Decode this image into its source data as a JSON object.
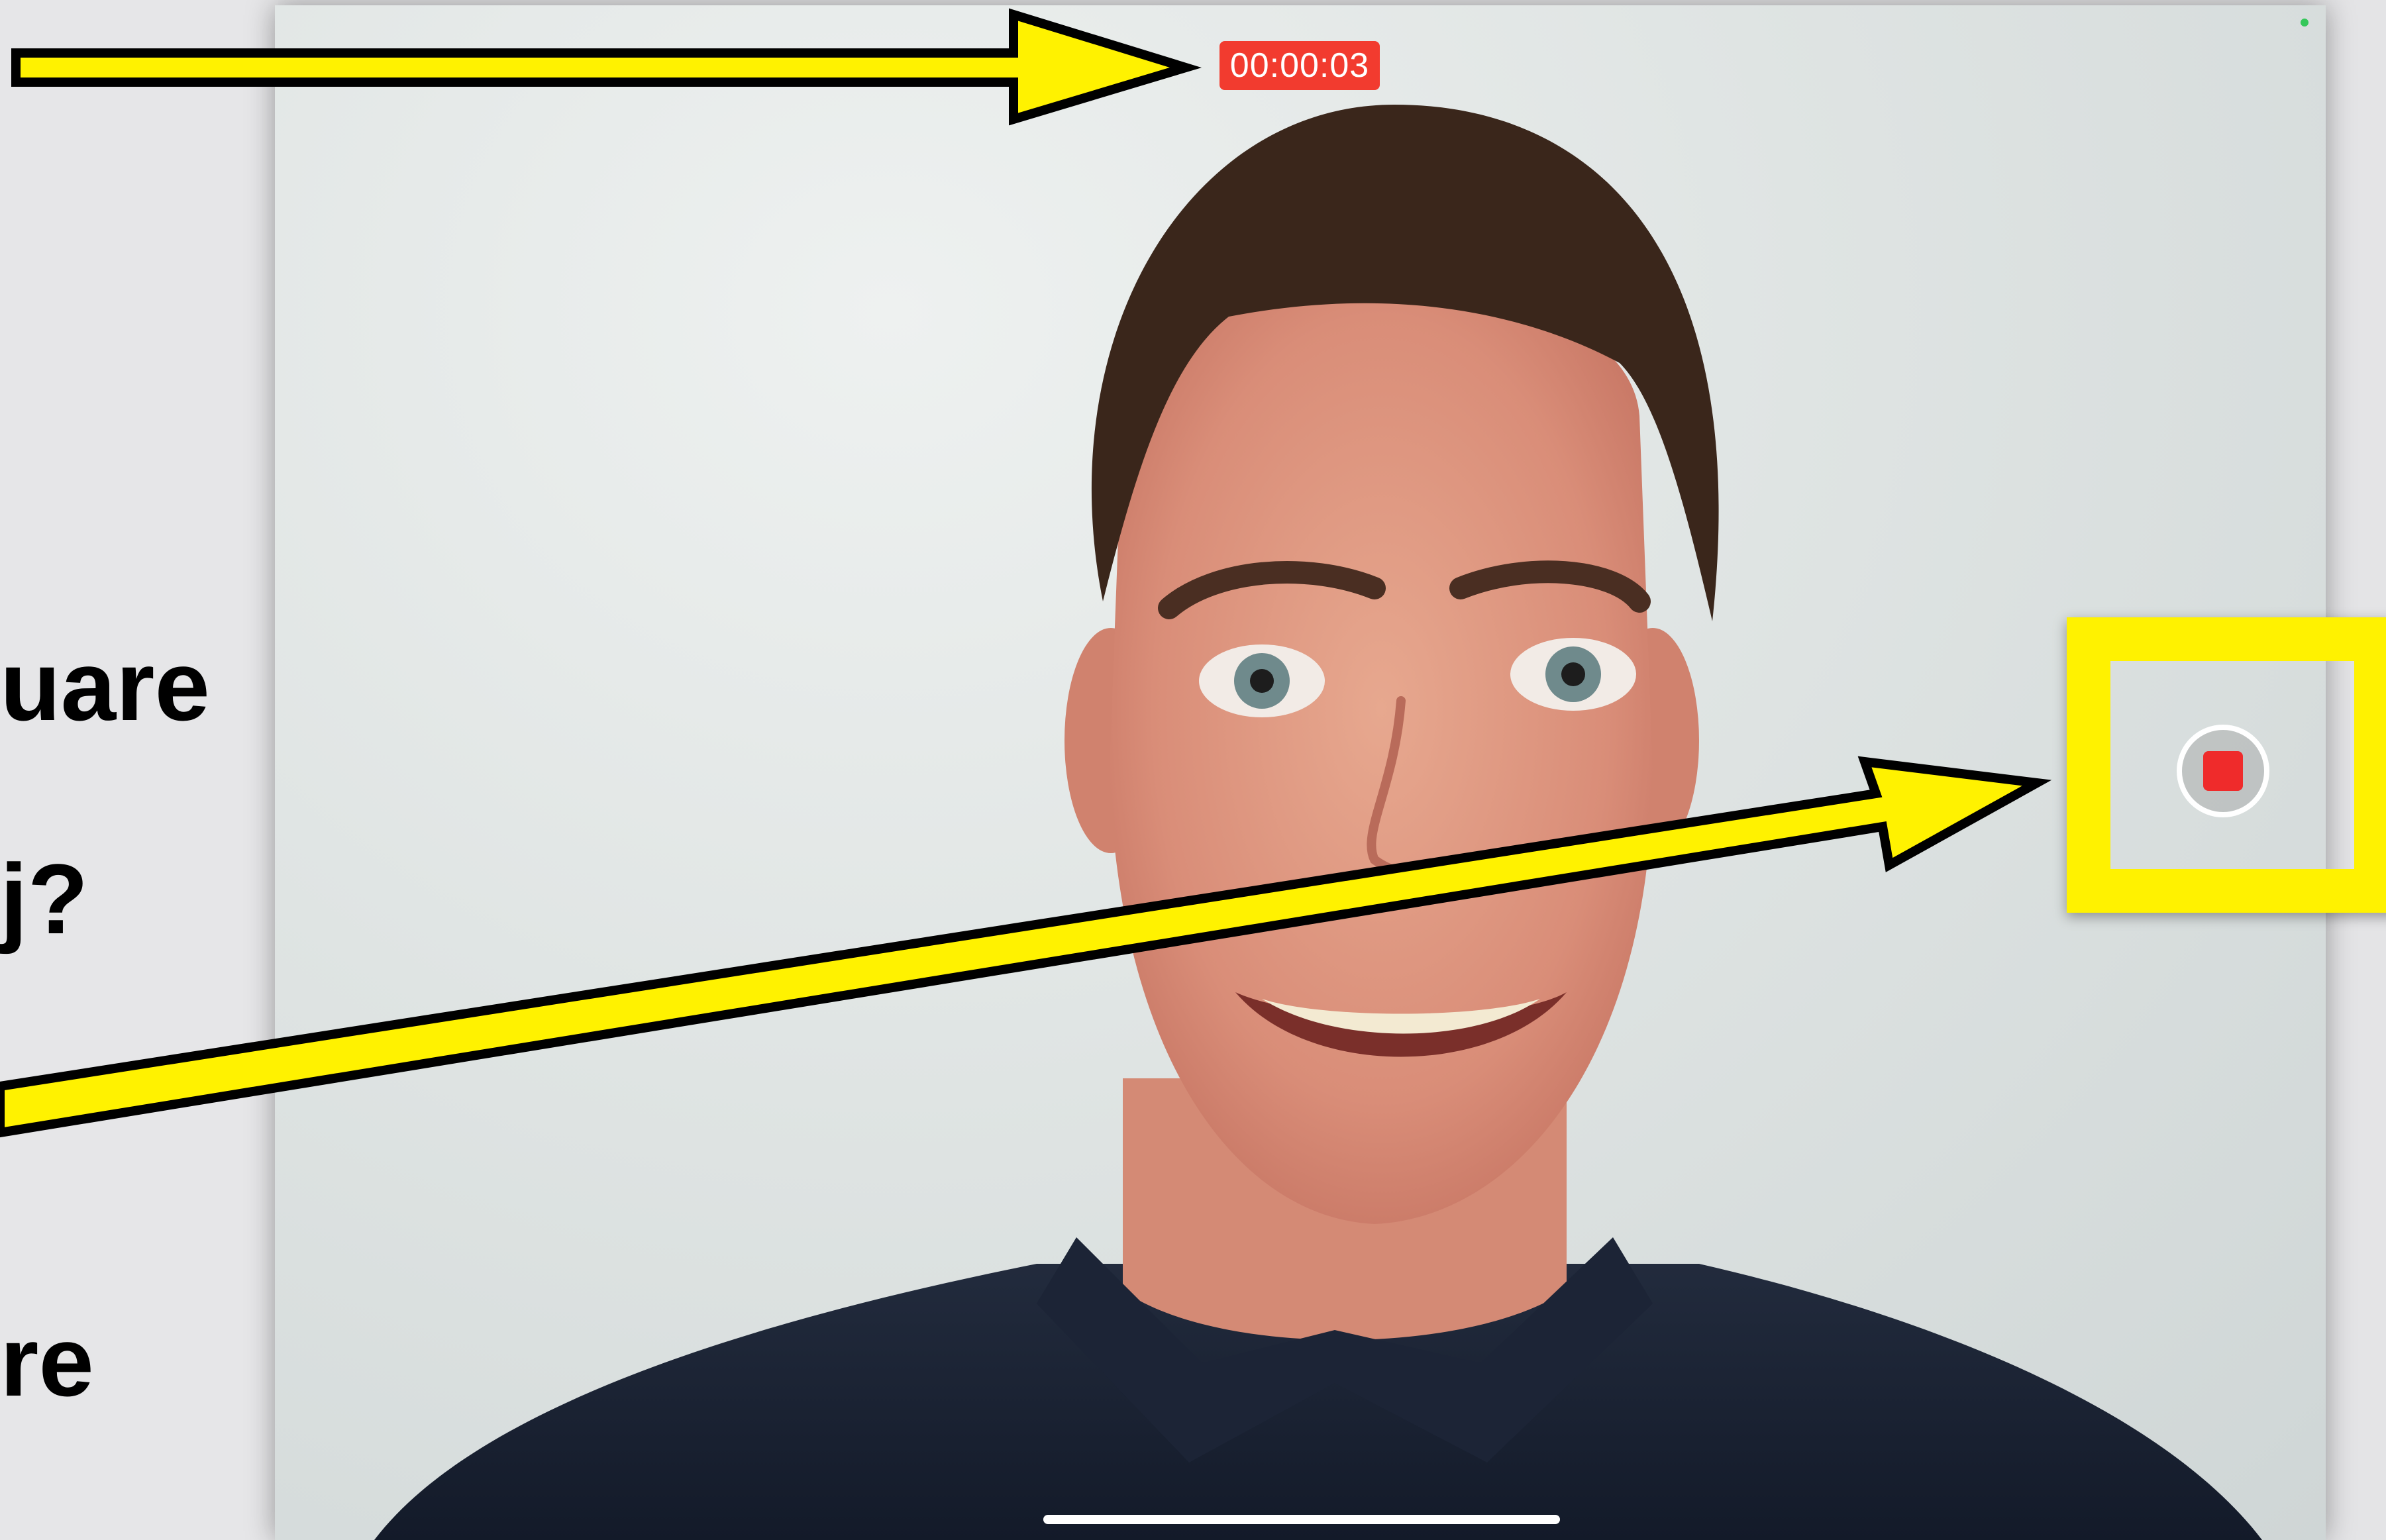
{
  "left_panel": {
    "lines": [
      "uare",
      "j?",
      "re"
    ]
  },
  "camera": {
    "timer": "00:00:03",
    "timer_color": "#f23b2f",
    "record_button_state": "recording",
    "stop_color": "#ef2b2b"
  },
  "annotations": {
    "arrow_color": "#fff200",
    "box_color": "#fff200",
    "arrows": [
      "arrow-to-timer",
      "arrow-to-record-button"
    ]
  },
  "icons": {
    "stop_record": "stop-record-icon",
    "status": "camera-in-use-dot-icon"
  }
}
